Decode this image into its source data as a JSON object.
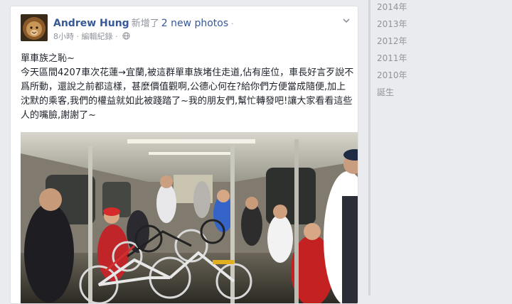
{
  "post": {
    "author": "Andrew Hung",
    "action": "新增了",
    "photos_link": "2 new photos",
    "separator": "·",
    "time": "8小時",
    "meta_separator": "·",
    "edit_history": "編輯紀錄",
    "meta_separator2": "·",
    "privacy_icon": "globe-icon",
    "menu_icon": "chevron-down-icon",
    "text_line1": "單車族之恥~",
    "text_body": "今天區間4207車次花蓮→宜蘭,被這群單車族堵住走道,佔有座位，車長好言歹說不爲所動，還說之前都這樣，甚麼價值觀啊,公德心何在?給你們方便當成隨便,加上沈默的乘客,我們的權益就如此被踐踏了~我的朋友們,幫忙轉發吧!讓大家看看這些人的嘴臉,謝謝了~",
    "photo_alt": "train-car-with-bicycles-photo"
  },
  "timeline_years": [
    "2014年",
    "2013年",
    "2012年",
    "2011年",
    "2010年",
    "誕生"
  ],
  "colors": {
    "link": "#365899",
    "muted": "#90949c",
    "text": "#1d2129",
    "page_bg": "#e9ebee"
  }
}
